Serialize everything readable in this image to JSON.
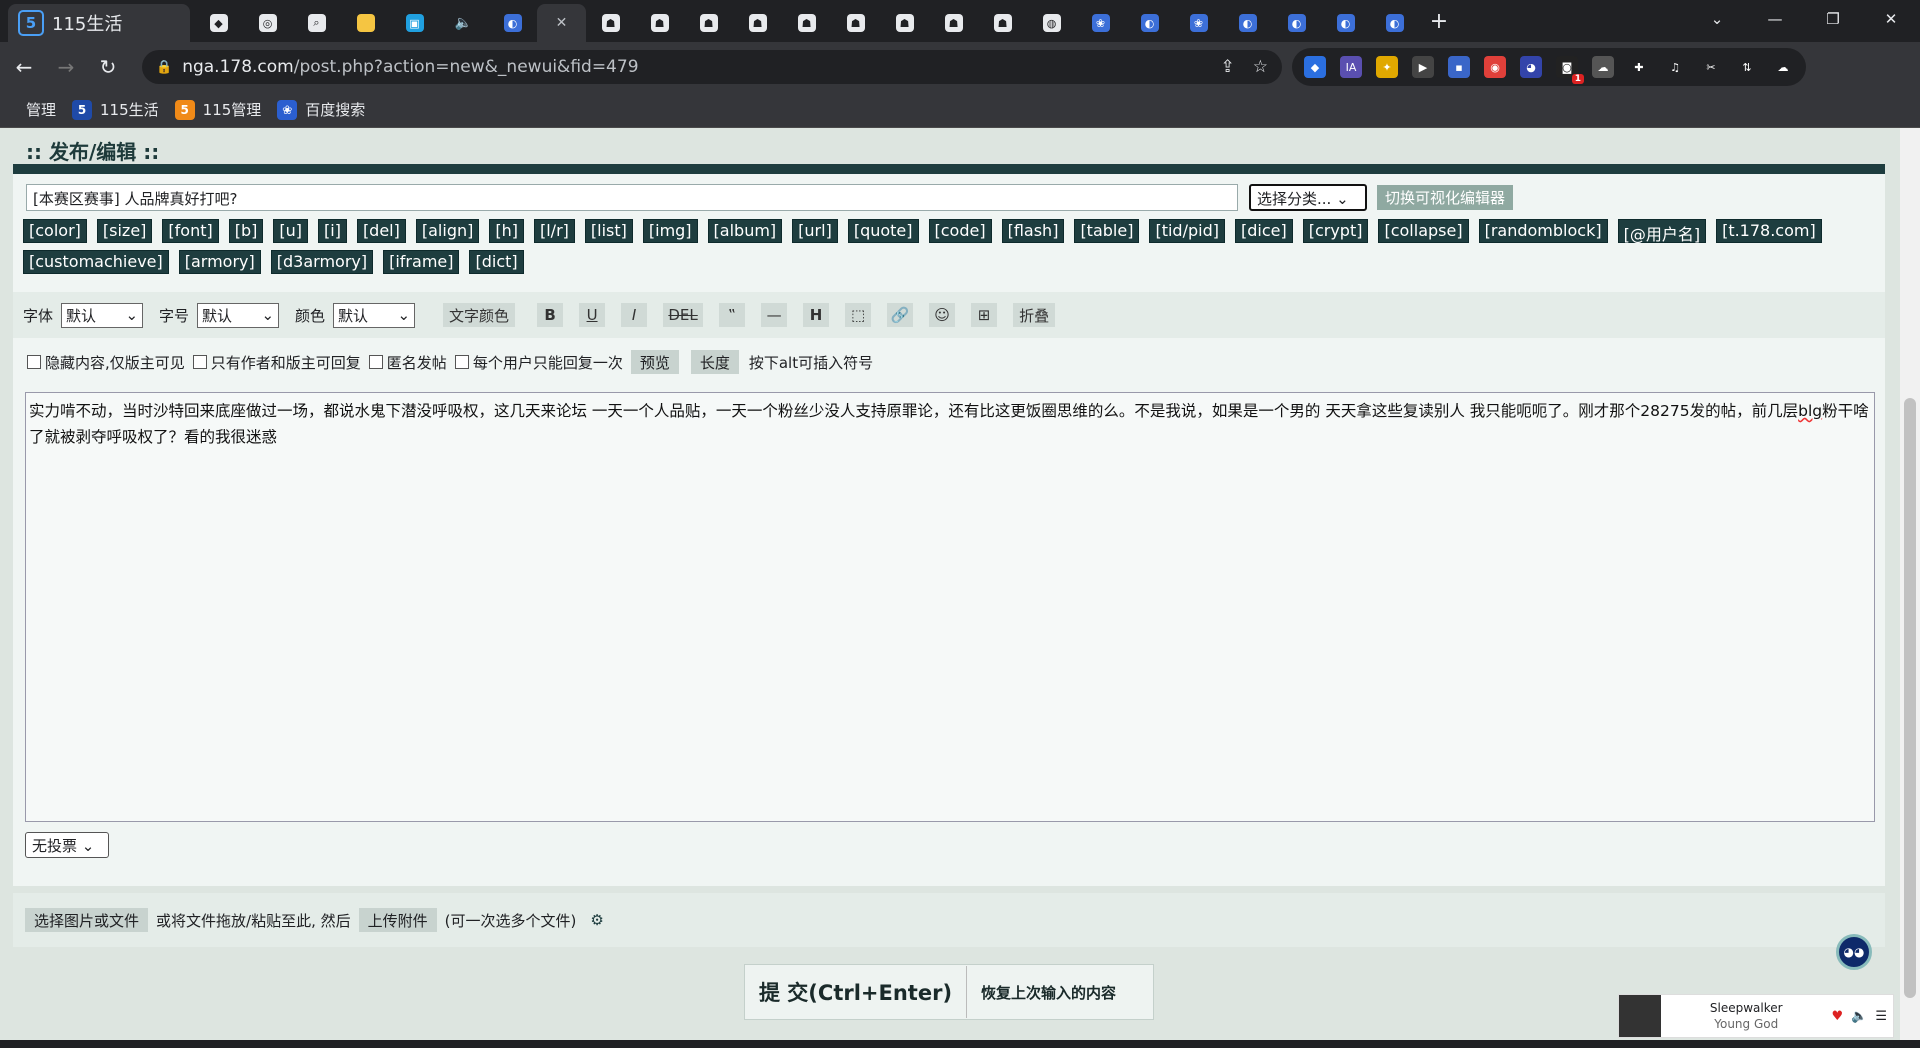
{
  "browser": {
    "active_tab_title": "115生活",
    "new_tab": "+",
    "url_host": "nga.178.com",
    "url_path": "/post.php?action=new&_newui&fid=479",
    "bookmarks": [
      {
        "label": "管理"
      },
      {
        "label": "115生活",
        "icon": "5"
      },
      {
        "label": "115管理",
        "icon": "5"
      },
      {
        "label": "百度搜索"
      }
    ],
    "ext_badge": "1"
  },
  "page": {
    "heading": ":: 发布/编辑 ::",
    "subject_value": "[本赛区赛事] 人品牌真好打吧?",
    "category_select": "选择分类...",
    "switch_editor": "切换可视化编辑器",
    "tags": [
      "[color]",
      "[size]",
      "[font]",
      "[b]",
      "[u]",
      "[i]",
      "[del]",
      "[align]",
      "[h]",
      "[l/r]",
      "[list]",
      "[img]",
      "[album]",
      "[url]",
      "[quote]",
      "[code]",
      "[flash]",
      "[table]",
      "[tid/pid]",
      "[dice]",
      "[crypt]",
      "[collapse]",
      "[randomblock]",
      "[@用户名]",
      "[t.178.com]",
      "[customachieve]",
      "[armory]",
      "[d3armory]",
      "[iframe]",
      "[dict]"
    ],
    "toolbar": {
      "font_label": "字体",
      "font_value": "默认",
      "size_label": "字号",
      "size_value": "默认",
      "color_label": "颜色",
      "color_value": "默认",
      "text_color_btn": "文字颜色",
      "bold": "B",
      "underline": "U",
      "italic": "I",
      "del": "DEL",
      "quote": "‟",
      "hr": "—",
      "heading": "H",
      "fold": "折叠"
    },
    "options": {
      "hide": "隐藏内容,仅版主可见",
      "author_only": "只有作者和版主可回复",
      "anonymous": "匿名发帖",
      "once": "每个用户只能回复一次",
      "preview": "预览",
      "length": "长度",
      "alt_hint": "按下alt可插入符号"
    },
    "body_part1": "实力啃不动，当时沙特回来底座做过一场，都说水鬼下潜没呼吸权，这几天来论坛 一天一个人品贴，一天一个粉丝少没人支持原罪论，还有比这更饭圈思维的么。不是我说，如果是一个男的 天天拿这些复读别人 我只能呃呃了。刚才那个28275发的帖，前几层",
    "body_err": "blg",
    "body_part2": "粉干啥了就被剥夺呼吸权了？看的我很迷惑",
    "poll": "无投票",
    "upload": {
      "choose": "选择图片或文件",
      "drag_hint": "或将文件拖放/粘贴至此, 然后",
      "upload_btn": "上传附件",
      "multi_hint": "(可一次选多个文件)"
    },
    "submit": "提 交(Ctrl+Enter)",
    "restore": "恢复上次输入的内容"
  },
  "player": {
    "title": "Sleepwalker",
    "artist": "Young God"
  }
}
